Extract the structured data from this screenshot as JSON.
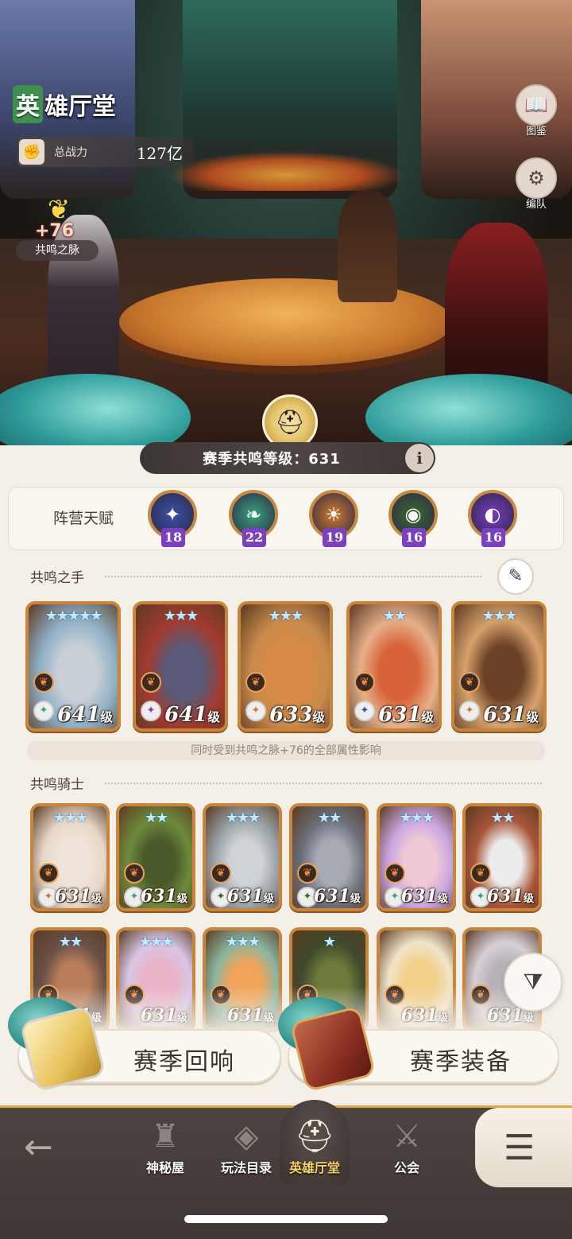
{
  "header": {
    "title_first_char": "英",
    "title_rest": "雄厅堂",
    "power_label": "总战力",
    "power_value": "127亿"
  },
  "resonance_pulse": {
    "bonus": "+76",
    "label": "共鸣之脉"
  },
  "side_buttons": [
    {
      "label": "图鉴",
      "icon": "book-icon"
    },
    {
      "label": "编队",
      "icon": "helmet-gear-icon"
    }
  ],
  "season_level": {
    "label": "赛季共鸣等级：631",
    "info": "i"
  },
  "faction_talent": {
    "title": "阵营天赋",
    "items": [
      {
        "count": "18",
        "icon": "star-compass-icon",
        "color": "#3d4fa3"
      },
      {
        "count": "22",
        "icon": "leaf-icon",
        "color": "#3aa27a"
      },
      {
        "count": "19",
        "icon": "sun-icon",
        "color": "#d37a2a"
      },
      {
        "count": "16",
        "icon": "eye-icon",
        "color": "#3b6b2c"
      },
      {
        "count": "16",
        "icon": "half-moon-icon",
        "color": "#7a3ac0"
      }
    ]
  },
  "resonance_hands": {
    "title": "共鸣之手",
    "heroes": [
      {
        "stars": "★★★★★",
        "level": "641",
        "unit": "级",
        "bg": "#8fb0c6",
        "skin": "#c9cfd6",
        "faction_color": "#3aa27a"
      },
      {
        "stars": "★★★",
        "level": "641",
        "unit": "级",
        "bg": "#a33a2f",
        "skin": "#5a5a78",
        "faction_color": "#7a3ac0"
      },
      {
        "stars": "★★★",
        "level": "633",
        "unit": "级",
        "bg": "#c98a4c",
        "skin": "#d98b45",
        "faction_color": "#d37a2a"
      },
      {
        "stars": "★★",
        "level": "631",
        "unit": "级",
        "bg": "#e6b08a",
        "skin": "#d8633a",
        "faction_color": "#3d4fa3"
      },
      {
        "stars": "★★★",
        "level": "631",
        "unit": "级",
        "bg": "#d8a16c",
        "skin": "#6b4226",
        "faction_color": "#d37a2a"
      }
    ],
    "hint": "同时受到共鸣之脉+76的全部属性影响"
  },
  "resonance_knights": {
    "title": "共鸣骑士",
    "row1": [
      {
        "stars": "★★★",
        "level": "631",
        "unit": "级",
        "bg": "#e7d6c7",
        "skin": "#efe4d9",
        "faction_color": "#d37a2a"
      },
      {
        "stars": "★★",
        "level": "631",
        "unit": "级",
        "bg": "#6f8a3c",
        "skin": "#4a5a2a",
        "faction_color": "#3aa27a"
      },
      {
        "stars": "★★★",
        "level": "631",
        "unit": "级",
        "bg": "#9aa3a8",
        "skin": "#cfd3d6",
        "faction_color": "#3b6b2c"
      },
      {
        "stars": "★★",
        "level": "631",
        "unit": "级",
        "bg": "#6b6f7a",
        "skin": "#a7aab3",
        "faction_color": "#3b6b2c"
      },
      {
        "stars": "★★★",
        "level": "631",
        "unit": "级",
        "bg": "#c9a6e0",
        "skin": "#f1c9d6",
        "faction_color": "#3aa27a"
      },
      {
        "stars": "★★",
        "level": "631",
        "unit": "级",
        "bg": "#a8563a",
        "skin": "#ececec",
        "faction_color": "#3aa27a"
      }
    ],
    "row2": [
      {
        "stars": "★★",
        "level": "631",
        "unit": "级",
        "bg": "#6a5148",
        "skin": "#b97d5a"
      },
      {
        "stars": "★★★",
        "level": "631",
        "unit": "级",
        "bg": "#d9c6e6",
        "skin": "#e9b3c8"
      },
      {
        "stars": "★★★",
        "level": "631",
        "unit": "级",
        "bg": "#8bb6a0",
        "skin": "#f0a45a"
      },
      {
        "stars": "★",
        "level": "631",
        "unit": "级",
        "bg": "#3f4a2c",
        "skin": "#6c7a3a"
      },
      {
        "stars": "",
        "level": "631",
        "unit": "级",
        "bg": "#f0e4c9",
        "skin": "#f2d08a"
      },
      {
        "stars": "",
        "level": "631",
        "unit": "级",
        "bg": "#d7cfd6",
        "skin": "#b8b2b8"
      }
    ]
  },
  "action_buttons": {
    "season_echo": "赛季回响",
    "season_gear": "赛季装备"
  },
  "bottom_nav": {
    "items": [
      {
        "label": "神秘屋",
        "icon": "castle-icon"
      },
      {
        "label": "玩法目录",
        "icon": "diamond-grid-icon"
      },
      {
        "label": "英雄厅堂",
        "icon": "helmet-icon"
      },
      {
        "label": "公会",
        "icon": "crossed-swords-icon"
      }
    ],
    "back_icon": "back-arrow-icon",
    "menu_icon": "menu-icon"
  },
  "colors": {
    "accent": "#e7a24a",
    "card_frame": "#c9853c",
    "nav_bg": "#3f3735"
  }
}
